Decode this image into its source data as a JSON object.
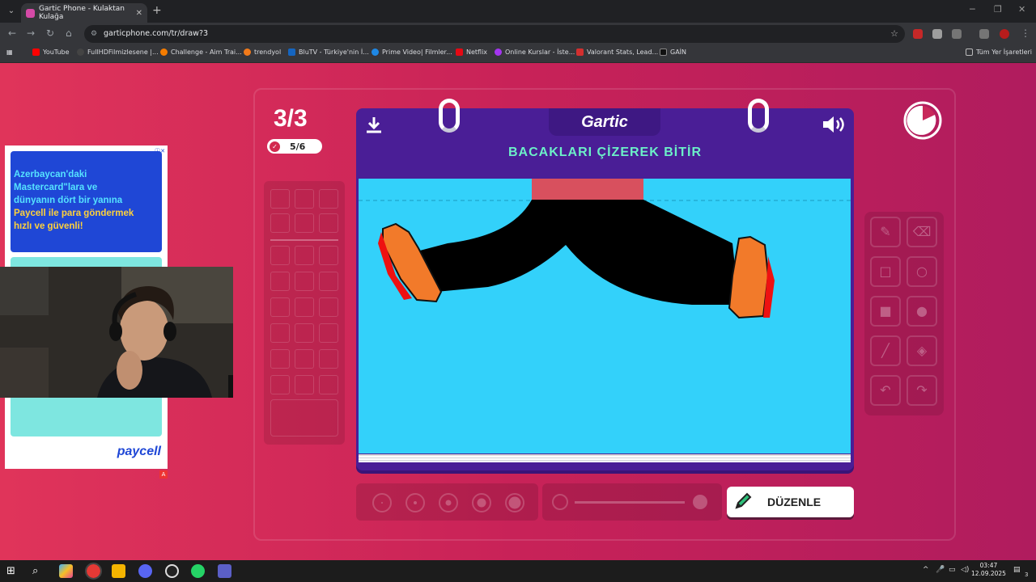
{
  "browser": {
    "tab_title": "Gartic Phone - Kulaktan Kulağa",
    "url": "garticphone.com/tr/draw?3",
    "bookmarks": [
      {
        "label": "YouTube",
        "color": "#ff0000"
      },
      {
        "label": "FullHDFilmizlesene |...",
        "color": "#444444"
      },
      {
        "label": "Challenge - Aim Trai...",
        "color": "#f57c00"
      },
      {
        "label": "trendyol",
        "color": "#f27a1a"
      },
      {
        "label": "BluTV - Türkiye'nin İ...",
        "color": "#1565c0"
      },
      {
        "label": "Prime Video| Filmler...",
        "color": "#1e88e5"
      },
      {
        "label": "Netflix",
        "color": "#e50914"
      },
      {
        "label": "Online Kurslar - İste...",
        "color": "#a435f0"
      },
      {
        "label": "Valorant Stats, Lead...",
        "color": "#d32f2f"
      },
      {
        "label": "GAİN",
        "color": "#111111"
      }
    ],
    "all_bookmarks": "Tüm Yer İşaretleri"
  },
  "game": {
    "round": "3/3",
    "players_done": "5/6",
    "logo": "Gartic",
    "instruction": "BACAKLARI ÇİZEREK BİTİR",
    "edit_button": "DÜZENLE",
    "accent": "#6cf0c8",
    "book_color": "#4a1e96"
  },
  "ad": {
    "line1": "Azerbaycan'daki",
    "line2": "Mastercard\"lara ve",
    "line3": "dünyanın dört bir yanına",
    "line4": "Paycell ile para göndermek",
    "line5": "hızlı ve güvenli!",
    "brand": "paycell",
    "badge": "A"
  },
  "taskbar": {
    "time": "03:47",
    "date": "12.09.2025",
    "notifications": "3"
  }
}
